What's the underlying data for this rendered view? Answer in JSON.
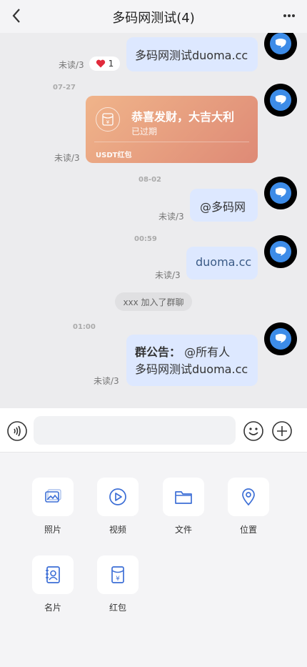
{
  "header": {
    "title": "多码网测试(4)",
    "back_icon": "back-chevron-icon",
    "more_icon": "more-dots-icon"
  },
  "messages": [
    {
      "text": "多码网测试duoma.cc",
      "unread": "未读/3",
      "reaction_count": "1"
    },
    {
      "time": "07-27",
      "red_packet": {
        "title": "恭喜发财，大吉大利",
        "status": "已过期",
        "type": "USDT红包"
      },
      "unread": "未读/3"
    },
    {
      "time": "08-02",
      "text": "@多码网",
      "unread": "未读/3"
    },
    {
      "time": "00:59",
      "text": "duoma.cc",
      "unread": "未读/3"
    },
    {
      "system": "xxx 加入了群聊"
    },
    {
      "time": "01:00",
      "announcement_label": "群公告：",
      "announcement_mention": "@所有人",
      "announcement_text": "多码网测试duoma.cc",
      "unread": "未读/3"
    }
  ],
  "input": {
    "placeholder": ""
  },
  "tools": [
    {
      "label": "照片",
      "icon": "photo-icon"
    },
    {
      "label": "视频",
      "icon": "video-icon"
    },
    {
      "label": "文件",
      "icon": "folder-icon"
    },
    {
      "label": "位置",
      "icon": "location-icon"
    },
    {
      "label": "名片",
      "icon": "contact-card-icon"
    },
    {
      "label": "红包",
      "icon": "red-packet-icon"
    }
  ],
  "colors": {
    "bubble": "#dde8ff",
    "accent": "#3d6fd6",
    "red_packet": "#e69a7f"
  }
}
